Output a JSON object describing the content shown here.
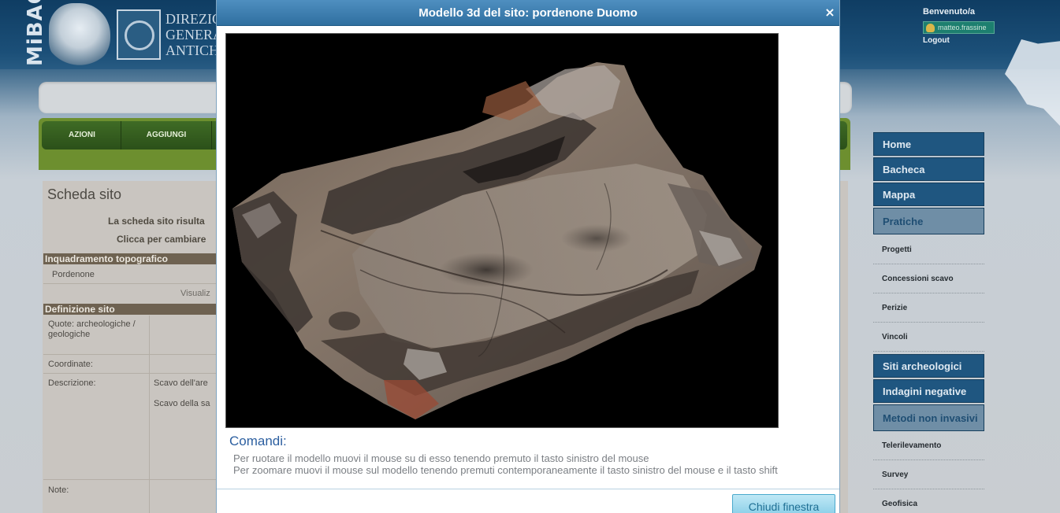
{
  "header": {
    "logo_text": "MiBAC",
    "logo_words": [
      "DIREZIO",
      "GENERA",
      "ANTICH"
    ],
    "welcome": "Benvenuto/a",
    "user": "matteo.frassine",
    "logout": "Logout"
  },
  "top_nav": {
    "items": [
      "AZIONI",
      "AGGIUNGI"
    ]
  },
  "page": {
    "title": "Scheda sito",
    "message_1": "La scheda sito risulta",
    "message_2": "Clicca per cambiare",
    "section_1": "Inquadramento topografico",
    "location": "Pordenone",
    "visualizza": "Visualiz",
    "section_2": "Definizione sito",
    "quote_label": "Quote: archeologiche / geologiche",
    "coordinate_label": "Coordinate:",
    "descrizione_label": "Descrizione:",
    "descrizione_1": "Scavo dell'are",
    "descrizione_2": "Scavo della sa",
    "note_label": "Note:"
  },
  "sidebar": {
    "items": [
      {
        "label": "Home",
        "type": "main"
      },
      {
        "label": "Bacheca",
        "type": "main"
      },
      {
        "label": "Mappa",
        "type": "main"
      },
      {
        "label": "Pratiche",
        "type": "main-selected"
      },
      {
        "label": "Progetti",
        "type": "sub"
      },
      {
        "label": "Concessioni scavo",
        "type": "sub"
      },
      {
        "label": "Perizie",
        "type": "sub"
      },
      {
        "label": "Vincoli",
        "type": "sub"
      },
      {
        "label": "Siti archeologici",
        "type": "main"
      },
      {
        "label": "Indagini negative",
        "type": "main"
      },
      {
        "label": "Metodi non invasivi",
        "type": "main-selected"
      },
      {
        "label": "Telerilevamento",
        "type": "sub"
      },
      {
        "label": "Survey",
        "type": "sub"
      },
      {
        "label": "Geofisica",
        "type": "sub"
      }
    ]
  },
  "modal": {
    "title": "Modello 3d del sito: pordenone Duomo",
    "close_glyph": "×",
    "commands_title": "Comandi:",
    "command_1": "Per ruotare il modello muovi il mouse su di esso tenendo premuto il tasto sinistro del mouse",
    "command_2": "Per zoomare muovi il mouse sul modello tenendo premuti contemporaneamente il tasto sinistro del mouse e il tasto shift",
    "close_button": "Chiudi finestra"
  },
  "colors": {
    "modal_title_bg": "#3d7fb0",
    "sidebar_main": "#1f5680",
    "nav_green": "#3f6b25",
    "commands_blue": "#2c5fa0"
  }
}
